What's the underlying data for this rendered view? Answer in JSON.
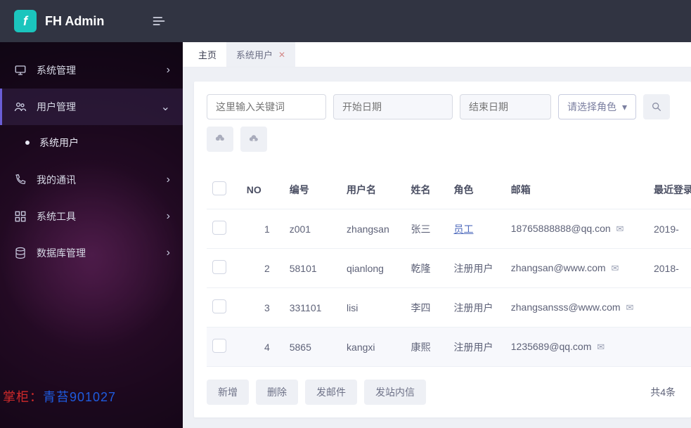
{
  "brand": {
    "name": "FH Admin",
    "logo_letter": "f"
  },
  "sidebar": {
    "items": [
      {
        "icon": "monitor",
        "label": "系统管理",
        "expandable": true
      },
      {
        "icon": "users",
        "label": "用户管理",
        "expandable": true,
        "open": true,
        "children": [
          {
            "label": "系统用户"
          }
        ]
      },
      {
        "icon": "phone",
        "label": "我的通讯",
        "expandable": true
      },
      {
        "icon": "grid",
        "label": "系统工具",
        "expandable": true
      },
      {
        "icon": "db",
        "label": "数据库管理",
        "expandable": true
      }
    ],
    "watermark_prefix": "掌柜：",
    "watermark_name": "青苔901027"
  },
  "tabs": {
    "home": "主页",
    "items": [
      {
        "label": "系统用户",
        "closable": true,
        "active": true
      }
    ]
  },
  "filters": {
    "keyword_placeholder": "这里输入关键词",
    "start_placeholder": "开始日期",
    "end_placeholder": "结束日期",
    "role_label": "请选择角色"
  },
  "table": {
    "columns": {
      "no": "NO",
      "code": "编号",
      "username": "用户名",
      "name": "姓名",
      "role": "角色",
      "email": "邮箱",
      "last": "最近登录"
    },
    "rows": [
      {
        "no": "1",
        "code": "z001",
        "username": "zhangsan",
        "name": "张三",
        "role": "员工",
        "role_link": true,
        "email": "18765888888@qq.con",
        "last": "2019-"
      },
      {
        "no": "2",
        "code": "58101",
        "username": "qianlong",
        "name": "乾隆",
        "role": "注册用户",
        "role_link": false,
        "email": "zhangsan@www.com",
        "last": "2018-"
      },
      {
        "no": "3",
        "code": "331101",
        "username": "lisi",
        "name": "李四",
        "role": "注册用户",
        "role_link": false,
        "email": "zhangsansss@www.com",
        "last": ""
      },
      {
        "no": "4",
        "code": "5865",
        "username": "kangxi",
        "name": "康熙",
        "role": "注册用户",
        "role_link": false,
        "email": "1235689@qq.com",
        "last": "",
        "hovered": true
      }
    ]
  },
  "actions": {
    "add": "新增",
    "delete": "删除",
    "mail": "发邮件",
    "msg": "发站内信"
  },
  "pager": {
    "total_text": "共4条"
  }
}
